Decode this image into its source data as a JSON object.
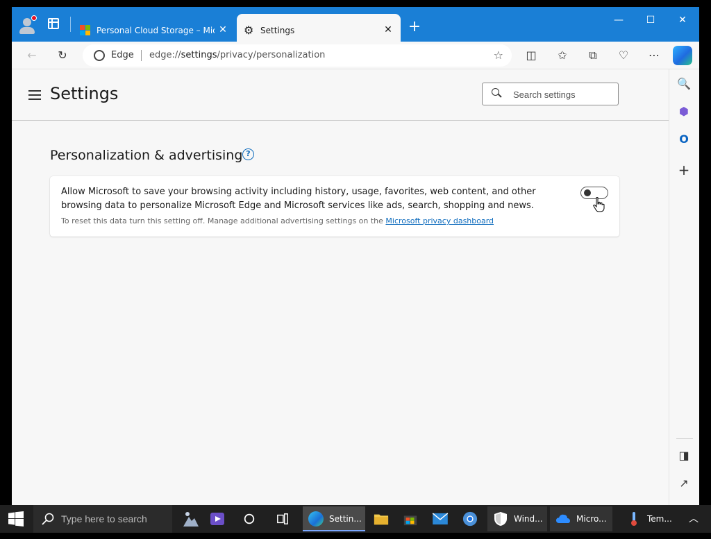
{
  "browser": {
    "tabs": [
      {
        "title": "Personal Cloud Storage – Micros",
        "active": false
      },
      {
        "title": "Settings",
        "active": true
      }
    ],
    "address": {
      "site_label": "Edge",
      "url_prefix": "edge://",
      "url_main": "settings",
      "url_rest": "/privacy/personalization"
    }
  },
  "settings": {
    "title": "Settings",
    "search_placeholder": "Search settings",
    "section_title": "Personalization & advertising",
    "card": {
      "main_text": "Allow Microsoft to save your browsing activity including history, usage, favorites, web content, and other browsing data to personalize Microsoft Edge and Microsoft services like ads, search, shopping and news.",
      "sub_text": "To reset this data turn this setting off. Manage additional advertising settings on the ",
      "link_text": "Microsoft privacy dashboard",
      "toggle_on": false
    }
  },
  "taskbar": {
    "search_placeholder": "Type here to search",
    "apps": [
      {
        "label": "Settin...",
        "state": "active"
      },
      {
        "label": "Wind...",
        "state": "open"
      },
      {
        "label": "Micro...",
        "state": "open"
      },
      {
        "label": "Tem...",
        "state": "plain"
      }
    ]
  },
  "colors": {
    "title_bar": "#1a7fd6",
    "accent": "#0f6cbd",
    "taskbar": "#202020"
  }
}
